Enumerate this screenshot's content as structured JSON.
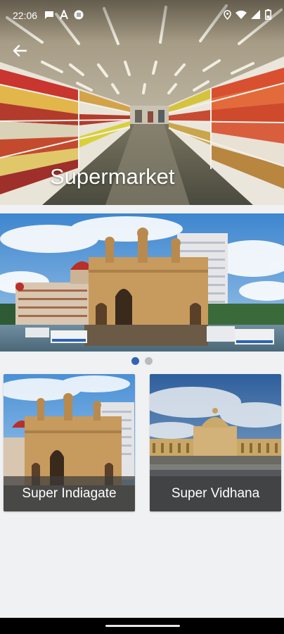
{
  "status_bar": {
    "time": "22:06",
    "left_icons": [
      "message-icon",
      "font-icon",
      "sync-icon"
    ],
    "right_icons": [
      "location-icon",
      "wifi-icon",
      "signal-icon",
      "battery-icon"
    ]
  },
  "header": {
    "title": "Supermarket",
    "back_icon": "arrow-left-icon"
  },
  "carousel": {
    "page_count": 2,
    "active_index": 0,
    "colors": {
      "active": "#2f63b4",
      "inactive": "#b9bbbf"
    }
  },
  "cards": [
    {
      "label": "Super Indiagate"
    },
    {
      "label": "Super Vidhana"
    }
  ]
}
